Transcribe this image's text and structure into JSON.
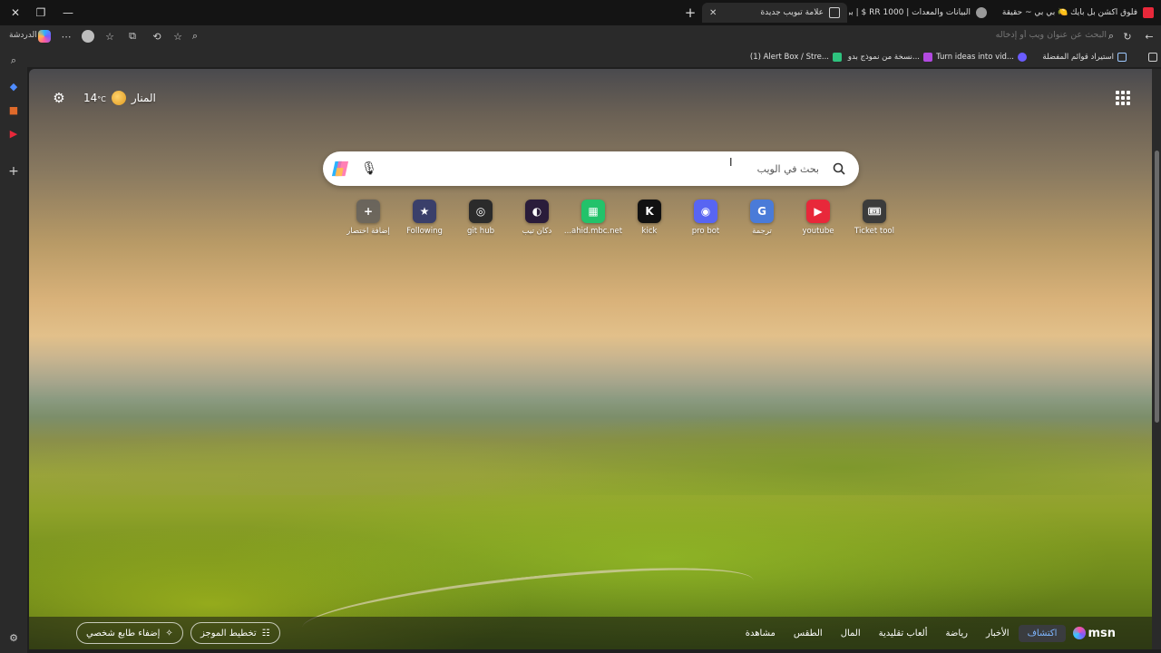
{
  "window": {
    "tabs": [
      {
        "title": "فلوق اكشن بل بايك 🍋 بي بي ~ حقيقة",
        "active": false,
        "color": "#e8283a"
      },
      {
        "title": "البيانات والمعدات | RR 1000 $ | بي",
        "active": false,
        "color": "#9a9a9a"
      },
      {
        "title": "علامة تبويب جديدة",
        "active": true,
        "color": "#cfcfcf"
      }
    ],
    "new_tab_icon": "plus-icon"
  },
  "addressbar": {
    "placeholder": "البحث عن عنوان ويب أو إدخاله",
    "copilot_label": "الدردشة"
  },
  "bookmarks": [
    {
      "label": "استيراد قوائم المفضلة",
      "color": "#9ec9ff"
    },
    {
      "label": "Turn ideas into vid...",
      "color": "#6b5cff"
    },
    {
      "label": "نسخة من نموذج بدو...",
      "color": "#b24ae0"
    },
    {
      "label": "(1) Alert Box / Stre...",
      "color": "#2ec27e"
    }
  ],
  "sidebar": {
    "items": [
      "search-icon",
      "tag-icon",
      "toolbox-icon",
      "youtube-icon",
      "plus-icon"
    ]
  },
  "weather": {
    "location": "المنار",
    "temp": "14",
    "unit": "°C"
  },
  "search": {
    "placeholder": "بحث في الويب"
  },
  "shortcuts": [
    {
      "label": "Ticket tool",
      "icon": "ticket-icon",
      "color": "#3b3b3b",
      "glyph": "🎟"
    },
    {
      "label": "youtube",
      "icon": "youtube-icon",
      "color": "#e8283a",
      "glyph": "▶"
    },
    {
      "label": "ترجمة",
      "icon": "translate-icon",
      "color": "#4a7bd8",
      "glyph": "G"
    },
    {
      "label": "pro bot",
      "icon": "discord-icon",
      "color": "#5865f2",
      "glyph": "◉"
    },
    {
      "label": "kick",
      "icon": "kick-icon",
      "color": "#111111",
      "glyph": "K"
    },
    {
      "label": "...ahid.mbc.net",
      "icon": "shahid-icon",
      "color": "#23c26a",
      "glyph": "▦"
    },
    {
      "label": "دكان تيب",
      "icon": "store-icon",
      "color": "#2a1c3a",
      "glyph": "◐"
    },
    {
      "label": "git hub",
      "icon": "github-icon",
      "color": "#2b2b2b",
      "glyph": "◎"
    },
    {
      "label": "Following",
      "icon": "star-icon",
      "color": "#3a3f6a",
      "glyph": "★"
    },
    {
      "label": "إضافة اختصار",
      "icon": "add-shortcut-icon",
      "color": "rgba(90,90,90,0.75)",
      "glyph": "+"
    }
  ],
  "bottombar": {
    "brand": "msn",
    "nav": [
      "اكتشاف",
      "الأخبار",
      "رياضة",
      "ألعاب تقليدية",
      "المال",
      "الطقس",
      "مشاهدة"
    ],
    "active_nav": "اكتشاف",
    "briefing_label": "تخطيط الموجز",
    "personalize_label": "إضفاء طابع شخصي"
  }
}
